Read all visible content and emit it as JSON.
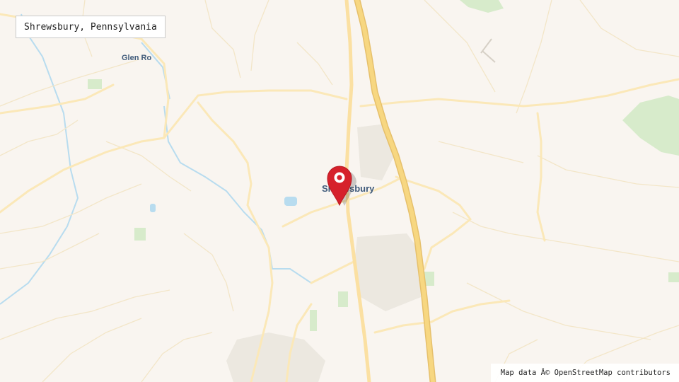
{
  "location_title": "Shrewsbury, Pennsylvania",
  "places": {
    "town": "Shrewsbury",
    "village": "Glen Ro"
  },
  "marker": {
    "icon": "map-pin-icon",
    "color": "#d6212b"
  },
  "attribution": "Map data Â© OpenStreetMap contributors",
  "colors": {
    "land": "#f9f5f0",
    "road": "#fbe8b8",
    "highway": "#f5d27a",
    "park": "#d7ebcb",
    "water": "#b8dcef",
    "marker": "#d6212b"
  }
}
